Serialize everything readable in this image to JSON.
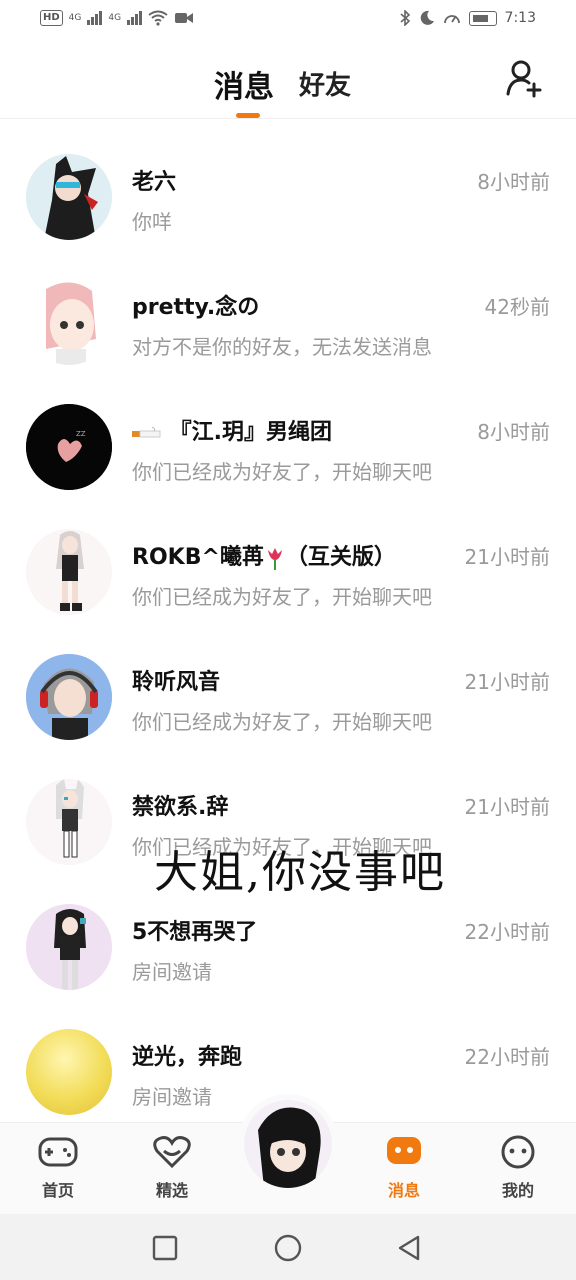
{
  "status_bar": {
    "left_badges": [
      "HD",
      "4G",
      "4G"
    ],
    "time": "7:13"
  },
  "header": {
    "tab_messages": "消息",
    "tab_friends": "好友",
    "add_friend_icon": "add-user-icon"
  },
  "conversations": [
    {
      "name": "老六",
      "preview": "你咩",
      "time": "8小时前"
    },
    {
      "name": "pretty.念の",
      "preview": "对方不是你的好友，无法发送消息",
      "time": "42秒前"
    },
    {
      "name": "『江.玥』男绳团",
      "preview": "你们已经成为好友了，开始聊天吧",
      "time": "8小时前"
    },
    {
      "name": "ROKB^曦苒",
      "name_suffix": "（互关版）",
      "preview": "你们已经成为好友了，开始聊天吧",
      "time": "21小时前"
    },
    {
      "name": "聆听风音",
      "preview": "你们已经成为好友了，开始聊天吧",
      "time": "21小时前"
    },
    {
      "name": "禁欲系.辞",
      "preview": "你们已经成为好友了，开始聊天吧",
      "time": "21小时前"
    },
    {
      "name": "5不想再哭了",
      "preview": "房间邀请",
      "time": "22小时前"
    },
    {
      "name": "逆光，奔跑",
      "preview": "房间邀请",
      "time": "22小时前"
    }
  ],
  "overlay_caption": "大姐,你没事吧",
  "bottom_nav": {
    "home": "首页",
    "featured": "精选",
    "messages": "消息",
    "mine": "我的"
  },
  "colors": {
    "accent": "#f07a10",
    "text_primary": "#111111",
    "text_secondary": "#9a9a9a"
  }
}
